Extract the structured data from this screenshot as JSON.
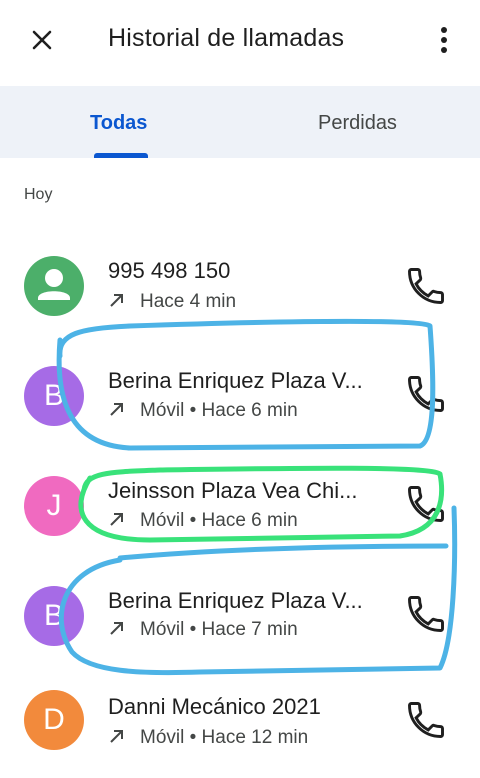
{
  "header": {
    "title": "Historial de llamadas",
    "close_icon": "close-icon",
    "menu_icon": "more-vert-icon"
  },
  "tabs": [
    {
      "label": "Todas",
      "selected": true
    },
    {
      "label": "Perdidas",
      "selected": false
    }
  ],
  "section_label": "Hoy",
  "colors": {
    "accent": "#0b57d0",
    "tab_bg": "#eef2f8",
    "annotation_blue": "#4db3e6",
    "annotation_green": "#39e27a"
  },
  "calls": [
    {
      "avatar_letter": "",
      "avatar_icon": "person-icon",
      "avatar_color": "#4caf6a",
      "name": "995 498 150",
      "direction_icon": "outgoing-call-icon",
      "detail": "Hace 4 min"
    },
    {
      "avatar_letter": "B",
      "avatar_color": "#a66be6",
      "name": "Berina Enriquez Plaza V...",
      "direction_icon": "outgoing-call-icon",
      "detail": "Móvil • Hace 6 min"
    },
    {
      "avatar_letter": "J",
      "avatar_color": "#f06ac0",
      "name": "Jeinsson Plaza Vea Chi...",
      "direction_icon": "outgoing-call-icon",
      "detail": "Móvil • Hace 6 min"
    },
    {
      "avatar_letter": "B",
      "avatar_color": "#a66be6",
      "name": "Berina Enriquez Plaza V...",
      "direction_icon": "outgoing-call-icon",
      "detail": "Móvil • Hace 7 min"
    },
    {
      "avatar_letter": "D",
      "avatar_color": "#f28a3c",
      "name": "Danni Mecánico 2021",
      "direction_icon": "outgoing-call-icon",
      "detail": "Móvil • Hace 12 min"
    }
  ]
}
